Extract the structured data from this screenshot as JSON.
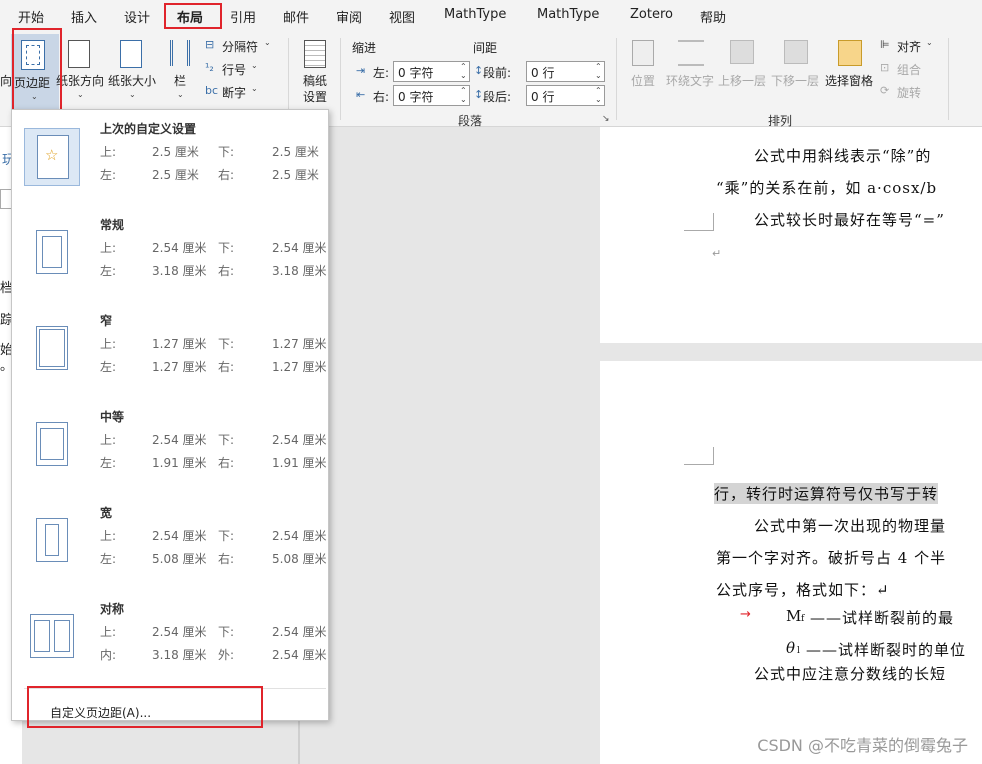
{
  "tabs": [
    "开始",
    "插入",
    "设计",
    "布局",
    "引用",
    "邮件",
    "审阅",
    "视图",
    "MathType",
    "MathType",
    "Zotero",
    "帮助"
  ],
  "ribbon": {
    "orientation_partial": "向",
    "margins": "页边距",
    "paper_orientation": "纸张方向",
    "paper_size": "纸张大小",
    "columns": "栏",
    "breaks": "分隔符",
    "line_numbers": "行号",
    "hyphenation": "断字",
    "draft_l1": "稿纸",
    "draft_l2": "设置",
    "indent_label": "缩进",
    "spacing_label": "间距",
    "indent_left_label": "左:",
    "indent_left_value": "0 字符",
    "indent_right_label": "右:",
    "indent_right_value": "0 字符",
    "space_before_label": "段前:",
    "space_before_value": "0 行",
    "space_after_label": "段后:",
    "space_after_value": "0 行",
    "group_paragraph": "段落",
    "position": "位置",
    "wrap_text": "环绕文字",
    "bring_forward": "上移一层",
    "send_backward": "下移一层",
    "selection_pane": "选择窗格",
    "align": "对齐",
    "group": "组合",
    "rotate": "旋转",
    "group_arrange": "排列"
  },
  "leftpane": [
    "玩",
    "档",
    "踪",
    "始",
    "。"
  ],
  "menu": {
    "items": [
      {
        "title": "上次的自定义设置",
        "k1": "上:",
        "v1": "2.5 厘米",
        "k2": "下:",
        "v2": "2.5 厘米",
        "k3": "左:",
        "v3": "2.5 厘米",
        "k4": "右:",
        "v4": "2.5 厘米"
      },
      {
        "title": "常规",
        "k1": "上:",
        "v1": "2.54 厘米",
        "k2": "下:",
        "v2": "2.54 厘米",
        "k3": "左:",
        "v3": "3.18 厘米",
        "k4": "右:",
        "v4": "3.18 厘米"
      },
      {
        "title": "窄",
        "k1": "上:",
        "v1": "1.27 厘米",
        "k2": "下:",
        "v2": "1.27 厘米",
        "k3": "左:",
        "v3": "1.27 厘米",
        "k4": "右:",
        "v4": "1.27 厘米"
      },
      {
        "title": "中等",
        "k1": "上:",
        "v1": "2.54 厘米",
        "k2": "下:",
        "v2": "2.54 厘米",
        "k3": "左:",
        "v3": "1.91 厘米",
        "k4": "右:",
        "v4": "1.91 厘米"
      },
      {
        "title": "宽",
        "k1": "上:",
        "v1": "2.54 厘米",
        "k2": "下:",
        "v2": "2.54 厘米",
        "k3": "左:",
        "v3": "5.08 厘米",
        "k4": "右:",
        "v4": "5.08 厘米"
      },
      {
        "title": "对称",
        "k1": "上:",
        "v1": "2.54 厘米",
        "k2": "下:",
        "v2": "2.54 厘米",
        "k3": "内:",
        "v3": "3.18 厘米",
        "k4": "外:",
        "v4": "2.54 厘米"
      }
    ],
    "custom": "自定义页边距(A)..."
  },
  "doc": {
    "p1": "公式中用斜线表示“除”的",
    "p2": "“乘”的关系在前，如 a·cosx/b",
    "p3": "公式较长时最好在等号“=”",
    "p4": "行，转行时运算符号仅书写于转",
    "p5": "公式中第一次出现的物理量",
    "p6": "第一个字对齐。破折号占 4 个半",
    "p7": "公式序号，格式如下：↵",
    "p8": "M",
    "p8sub": "f",
    "p8b": "——试样断裂前的最",
    "p9": "θ",
    "p9sub": "l",
    "p9b": "——试样断裂时的单位",
    "p10": "公式中应注意分数线的长短",
    "arrow": "→",
    "mark": "↵"
  },
  "watermark": "CSDN @不吃青菜的倒霉兔子"
}
